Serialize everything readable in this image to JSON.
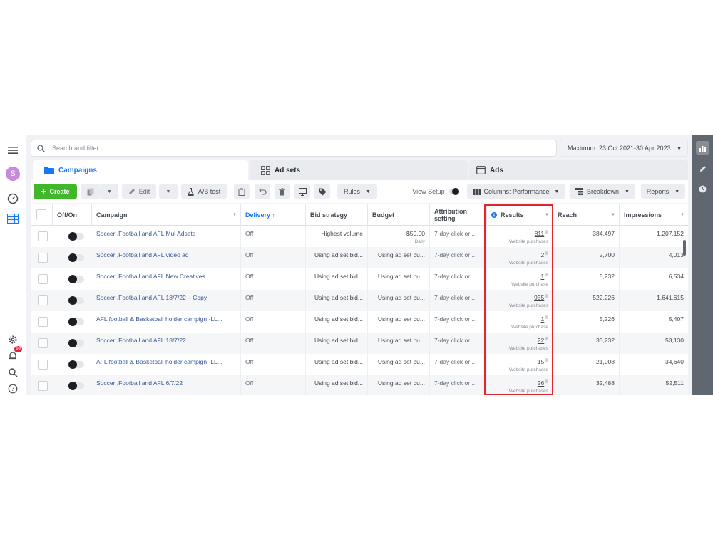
{
  "leftrail": {
    "avatar_letter": "S",
    "notification_count": "99"
  },
  "search": {
    "placeholder": "Search and filter"
  },
  "daterange": {
    "label": "Maximum: 23 Oct 2021-30 Apr 2023"
  },
  "tabs": [
    {
      "label": "Campaigns",
      "active": true
    },
    {
      "label": "Ad sets",
      "active": false
    },
    {
      "label": "Ads",
      "active": false
    }
  ],
  "toolbar": {
    "create_label": "Create",
    "edit_label": "Edit",
    "ab_test_label": "A/B test",
    "rules_label": "Rules",
    "view_setup_label": "View Setup",
    "columns_label": "Columns: Performance",
    "breakdown_label": "Breakdown",
    "reports_label": "Reports"
  },
  "table": {
    "headers": {
      "offon": "Off/On",
      "campaign": "Campaign",
      "delivery": "Delivery ↑",
      "bid_strategy": "Bid strategy",
      "budget": "Budget",
      "attribution": "Attribution setting",
      "results": "Results",
      "reach": "Reach",
      "impressions": "Impressions"
    },
    "rows": [
      {
        "campaign": "Soccer ,Football and AFL Mul Adsets",
        "delivery": "Off",
        "bid": "Highest volume",
        "budget": "$50.00",
        "budget_sub": "Daily",
        "attribution": "7-day click or ...",
        "results": "811",
        "results_sub": "Website purchases",
        "reach": "384,497",
        "impressions": "1,207,152"
      },
      {
        "campaign": "Soccer ,Football and AFL video ad",
        "delivery": "Off",
        "bid": "Using ad set bid...",
        "budget": "Using ad set bu...",
        "budget_sub": "",
        "attribution": "7-day click or ...",
        "results": "2",
        "results_sub": "Website purchases",
        "reach": "2,700",
        "impressions": "4,013"
      },
      {
        "campaign": "Soccer ,Football and AFL New Creatives",
        "delivery": "Off",
        "bid": "Using ad set bid...",
        "budget": "Using ad set bu...",
        "budget_sub": "",
        "attribution": "7-day click or ...",
        "results": "1",
        "results_sub": "Website purchase",
        "reach": "5,232",
        "impressions": "6,534"
      },
      {
        "campaign": "Soccer ,Football and AFL 18/7/22 – Copy",
        "delivery": "Off",
        "bid": "Using ad set bid...",
        "budget": "Using ad set bu...",
        "budget_sub": "",
        "attribution": "7-day click or ...",
        "results": "935",
        "results_sub": "Website purchases",
        "reach": "522,226",
        "impressions": "1,641,615"
      },
      {
        "campaign": "AFL football & Basketball holder campign -LL...",
        "delivery": "Off",
        "bid": "Using ad set bid...",
        "budget": "Using ad set bu...",
        "budget_sub": "",
        "attribution": "7-day click or ...",
        "results": "1",
        "results_sub": "Website purchase",
        "reach": "5,226",
        "impressions": "5,407"
      },
      {
        "campaign": "Soccer ,Football and AFL 18/7/22",
        "delivery": "Off",
        "bid": "Using ad set bid...",
        "budget": "Using ad set bu...",
        "budget_sub": "",
        "attribution": "7-day click or ...",
        "results": "22",
        "results_sub": "Website purchases",
        "reach": "33,232",
        "impressions": "53,130"
      },
      {
        "campaign": "AFL football & Basketball holder campign -LL...",
        "delivery": "Off",
        "bid": "Using ad set bid...",
        "budget": "Using ad set bu...",
        "budget_sub": "",
        "attribution": "7-day click or ...",
        "results": "15",
        "results_sub": "Website purchases",
        "reach": "21,008",
        "impressions": "34,640"
      },
      {
        "campaign": "Soccer ,Football and AFL 6/7/22",
        "delivery": "Off",
        "bid": "Using ad set bid...",
        "budget": "Using ad set bu...",
        "budget_sub": "",
        "attribution": "7-day click or ...",
        "results": "26",
        "results_sub": "Website purchases",
        "reach": "32,488",
        "impressions": "52,511"
      }
    ]
  },
  "colors": {
    "accent": "#1877f2",
    "create": "#42b72a",
    "highlight_box": "#e0262f",
    "link": "#385898"
  }
}
